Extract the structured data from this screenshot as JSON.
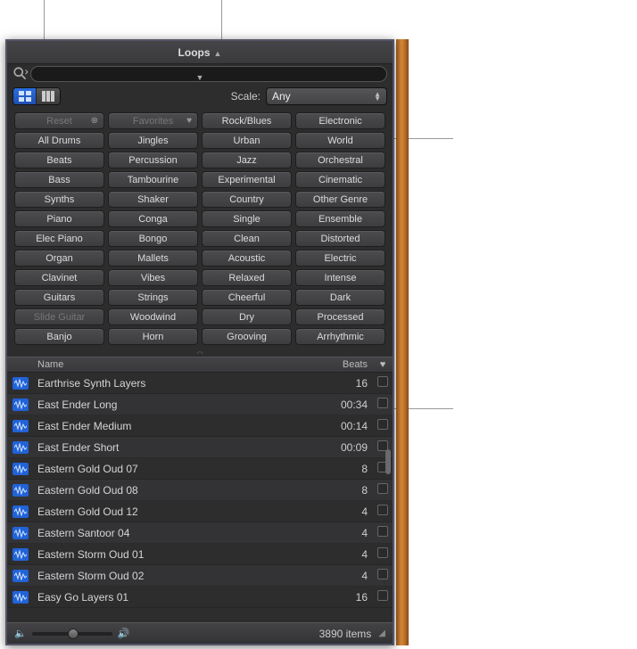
{
  "header": {
    "title": "Loops"
  },
  "toolbar": {
    "scale_label": "Scale:",
    "scale_value": "Any"
  },
  "tags": {
    "rows": [
      [
        "Reset",
        "Favorites",
        "Rock/Blues",
        "Electronic"
      ],
      [
        "All Drums",
        "Jingles",
        "Urban",
        "World"
      ],
      [
        "Beats",
        "Percussion",
        "Jazz",
        "Orchestral"
      ],
      [
        "Bass",
        "Tambourine",
        "Experimental",
        "Cinematic"
      ],
      [
        "Synths",
        "Shaker",
        "Country",
        "Other Genre"
      ],
      [
        "Piano",
        "Conga",
        "Single",
        "Ensemble"
      ],
      [
        "Elec Piano",
        "Bongo",
        "Clean",
        "Distorted"
      ],
      [
        "Organ",
        "Mallets",
        "Acoustic",
        "Electric"
      ],
      [
        "Clavinet",
        "Vibes",
        "Relaxed",
        "Intense"
      ],
      [
        "Guitars",
        "Strings",
        "Cheerful",
        "Dark"
      ],
      [
        "Slide Guitar",
        "Woodwind",
        "Dry",
        "Processed"
      ],
      [
        "Banjo",
        "Horn",
        "Grooving",
        "Arrhythmic"
      ]
    ],
    "dim": [
      "Reset",
      "Favorites",
      "Slide Guitar"
    ]
  },
  "columns": {
    "name": "Name",
    "beats": "Beats",
    "fav": "♥"
  },
  "loops": [
    {
      "name": "Earthrise Synth Layers",
      "beats": "16"
    },
    {
      "name": "East Ender Long",
      "beats": "00:34"
    },
    {
      "name": "East Ender Medium",
      "beats": "00:14"
    },
    {
      "name": "East Ender Short",
      "beats": "00:09"
    },
    {
      "name": "Eastern Gold Oud 07",
      "beats": "8"
    },
    {
      "name": "Eastern Gold Oud 08",
      "beats": "8"
    },
    {
      "name": "Eastern Gold Oud 12",
      "beats": "4"
    },
    {
      "name": "Eastern Santoor 04",
      "beats": "4"
    },
    {
      "name": "Eastern Storm Oud 01",
      "beats": "4"
    },
    {
      "name": "Eastern Storm Oud 02",
      "beats": "4"
    },
    {
      "name": "Easy Go Layers 01",
      "beats": "16"
    }
  ],
  "footer": {
    "count": "3890 items"
  }
}
